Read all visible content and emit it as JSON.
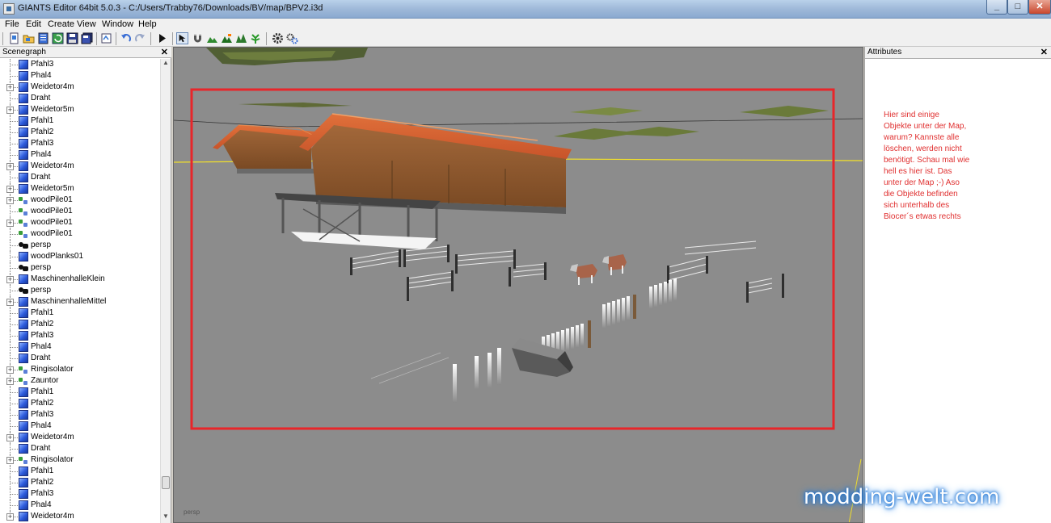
{
  "window": {
    "title": "GIANTS Editor 64bit 5.0.3 - C:/Users/Trabby76/Downloads/BV/map/BPV2.i3d",
    "minimize": "_",
    "maximize": "□",
    "close": "✕"
  },
  "menu": {
    "items": [
      "File",
      "Edit",
      "Create",
      "View",
      "Window",
      "Help"
    ]
  },
  "toolbar": {
    "icons": [
      "new-icon",
      "open-icon",
      "save-list-icon",
      "refresh-icon",
      "save-icon",
      "save-all-icon",
      "export-icon",
      "undo-icon",
      "redo-icon",
      "play-icon",
      "select-mode-icon",
      "magnet-icon",
      "terrain-icon",
      "terrain-paint-icon",
      "foliage-icon",
      "sculpt-icon",
      "settings-gear-icon",
      "cogs-icon"
    ]
  },
  "scenegraph": {
    "title": "Scenegraph",
    "close": "✕",
    "items": [
      {
        "label": "Pfahl3",
        "type": "shape",
        "expandable": false
      },
      {
        "label": "Phal4",
        "type": "shape",
        "expandable": false
      },
      {
        "label": "Weidetor4m",
        "type": "shape",
        "expandable": true
      },
      {
        "label": "Draht",
        "type": "shape",
        "expandable": false
      },
      {
        "label": "Weidetor5m",
        "type": "shape",
        "expandable": true
      },
      {
        "label": "Pfahl1",
        "type": "shape",
        "expandable": false
      },
      {
        "label": "Pfahl2",
        "type": "shape",
        "expandable": false
      },
      {
        "label": "Pfahl3",
        "type": "shape",
        "expandable": false
      },
      {
        "label": "Phal4",
        "type": "shape",
        "expandable": false
      },
      {
        "label": "Weidetor4m",
        "type": "shape",
        "expandable": true
      },
      {
        "label": "Draht",
        "type": "shape",
        "expandable": false
      },
      {
        "label": "Weidetor5m",
        "type": "shape",
        "expandable": true
      },
      {
        "label": "woodPile01",
        "type": "group",
        "expandable": true
      },
      {
        "label": "woodPile01",
        "type": "group",
        "expandable": false
      },
      {
        "label": "woodPile01",
        "type": "group",
        "expandable": true
      },
      {
        "label": "woodPile01",
        "type": "group",
        "expandable": false
      },
      {
        "label": "persp",
        "type": "camera",
        "expandable": false
      },
      {
        "label": "woodPlanks01",
        "type": "shape",
        "expandable": false
      },
      {
        "label": "persp",
        "type": "camera",
        "expandable": false
      },
      {
        "label": "MaschinenhalleKlein",
        "type": "shape",
        "expandable": true
      },
      {
        "label": "persp",
        "type": "camera",
        "expandable": false
      },
      {
        "label": "MaschinenhalleMittel",
        "type": "shape",
        "expandable": true
      },
      {
        "label": "Pfahl1",
        "type": "shape",
        "expandable": false
      },
      {
        "label": "Pfahl2",
        "type": "shape",
        "expandable": false
      },
      {
        "label": "Pfahl3",
        "type": "shape",
        "expandable": false
      },
      {
        "label": "Phal4",
        "type": "shape",
        "expandable": false
      },
      {
        "label": "Draht",
        "type": "shape",
        "expandable": false
      },
      {
        "label": "Ringisolator",
        "type": "group",
        "expandable": true
      },
      {
        "label": "Zauntor",
        "type": "group",
        "expandable": true
      },
      {
        "label": "Pfahl1",
        "type": "shape",
        "expandable": false
      },
      {
        "label": "Pfahl2",
        "type": "shape",
        "expandable": false
      },
      {
        "label": "Pfahl3",
        "type": "shape",
        "expandable": false
      },
      {
        "label": "Phal4",
        "type": "shape",
        "expandable": false
      },
      {
        "label": "Weidetor4m",
        "type": "shape",
        "expandable": true
      },
      {
        "label": "Draht",
        "type": "shape",
        "expandable": false
      },
      {
        "label": "Ringisolator",
        "type": "group",
        "expandable": true
      },
      {
        "label": "Pfahl1",
        "type": "shape",
        "expandable": false
      },
      {
        "label": "Pfahl2",
        "type": "shape",
        "expandable": false
      },
      {
        "label": "Pfahl3",
        "type": "shape",
        "expandable": false
      },
      {
        "label": "Phal4",
        "type": "shape",
        "expandable": false
      },
      {
        "label": "Weidetor4m",
        "type": "shape",
        "expandable": true
      }
    ]
  },
  "viewport": {
    "camera_label": "persp",
    "highlight_color": "#e8262a",
    "background_color": "#8c8c8c"
  },
  "attributes": {
    "title": "Attributes",
    "close": "✕",
    "note_lines": [
      "Hier sind einige",
      "Objekte unter der Map,",
      "warum? Kannste alle",
      "löschen, werden nicht",
      "benötigt. Schau mal wie",
      "hell es hier ist. Das",
      "unter der Map ;-) Aso",
      "die Objekte befinden",
      "sich unterhalb des",
      "Biocer´s etwas rechts"
    ],
    "note_color": "#e03030"
  },
  "watermark": {
    "text": "modding-welt.com"
  }
}
